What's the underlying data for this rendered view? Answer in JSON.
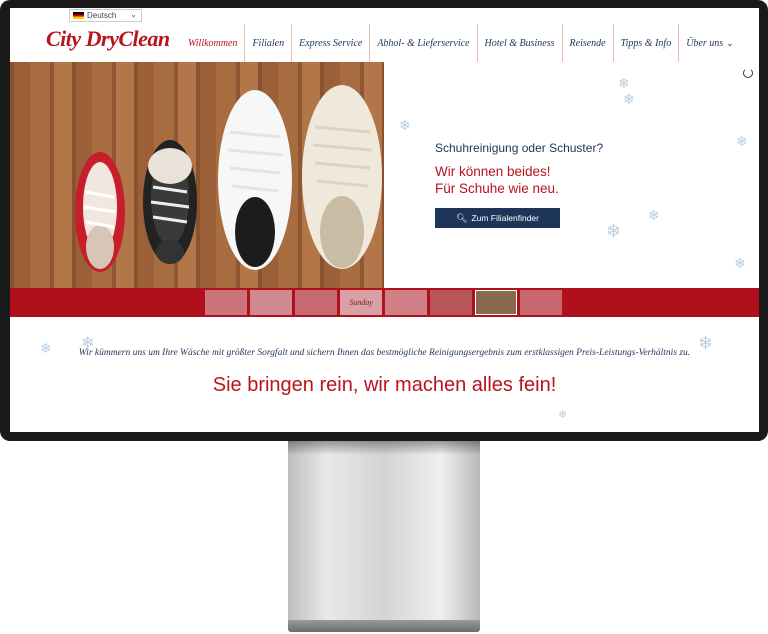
{
  "header": {
    "language": "Deutsch",
    "logo": "City DryClean",
    "nav": [
      {
        "label": "Willkommen",
        "active": true
      },
      {
        "label": "Filialen"
      },
      {
        "label": "Express Service"
      },
      {
        "label": "Abhol- & Lieferservice"
      },
      {
        "label": "Hotel & Business"
      },
      {
        "label": "Reisende"
      },
      {
        "label": "Tipps & Info"
      },
      {
        "label": "Über uns"
      }
    ]
  },
  "hero": {
    "question": "Schuhreinigung oder Schuster?",
    "line1": "Wir können beides!",
    "line2": "Für Schuhe wie neu.",
    "button_label": "Zum Filialenfinder",
    "button_icon": "search-icon",
    "image_alt_icon": "shoes-photo"
  },
  "strip": {
    "thumb_caption": "Sunday"
  },
  "content": {
    "tagline": "Wir kümmern uns um Ihre Wäsche mit größter Sorgfalt und sichern Ihnen das bestmögliche Reinigungsergebnis zum erstklassigen Preis-Leistungs-Verhältnis zu.",
    "slogan_part1": "Sie bringen rein,",
    "slogan_part2": " wir machen alles fein!"
  },
  "colors": {
    "brand_red": "#b8141d",
    "navy": "#1d3558",
    "strip_red": "#b00f1c"
  }
}
